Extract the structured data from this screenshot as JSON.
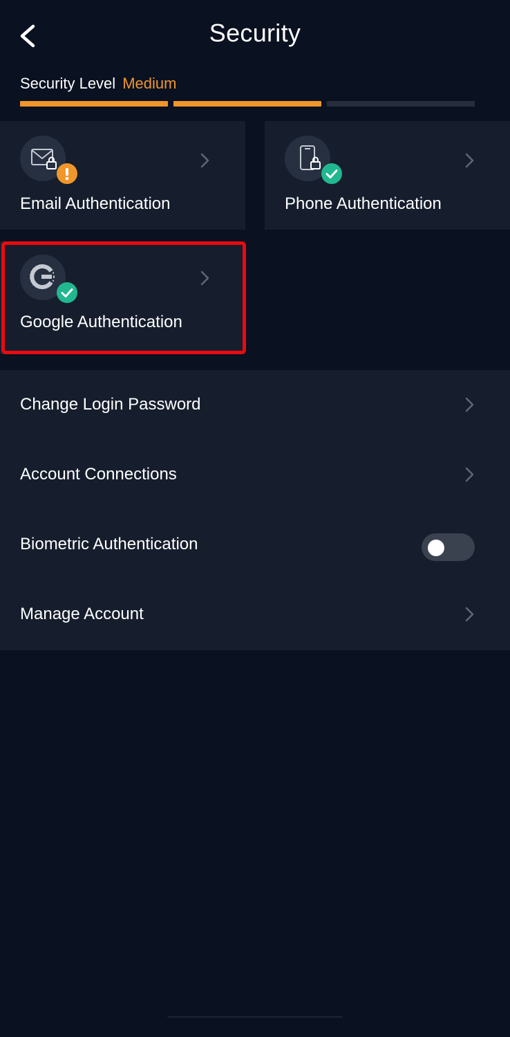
{
  "header": {
    "title": "Security"
  },
  "security_level": {
    "label": "Security Level",
    "value": "Medium",
    "value_color": "#f0962b",
    "filled_segments": 2,
    "total_segments": 3,
    "filled_color": "#f0962b",
    "empty_color": "#262e3c"
  },
  "auth_methods": [
    {
      "label": "Email Authentication",
      "icon": "envelope-lock-icon",
      "status": "warning",
      "badge_color": "#f0962b"
    },
    {
      "label": "Phone Authentication",
      "icon": "phone-lock-icon",
      "status": "verified",
      "badge_color": "#21b78f"
    },
    {
      "label": "Google Authentication",
      "icon": "google-authenticator-icon",
      "status": "verified",
      "badge_color": "#21b78f"
    }
  ],
  "settings": {
    "change_password": "Change Login Password",
    "account_connections": "Account Connections",
    "biometric": "Biometric Authentication",
    "biometric_enabled": false,
    "manage_account": "Manage Account"
  }
}
